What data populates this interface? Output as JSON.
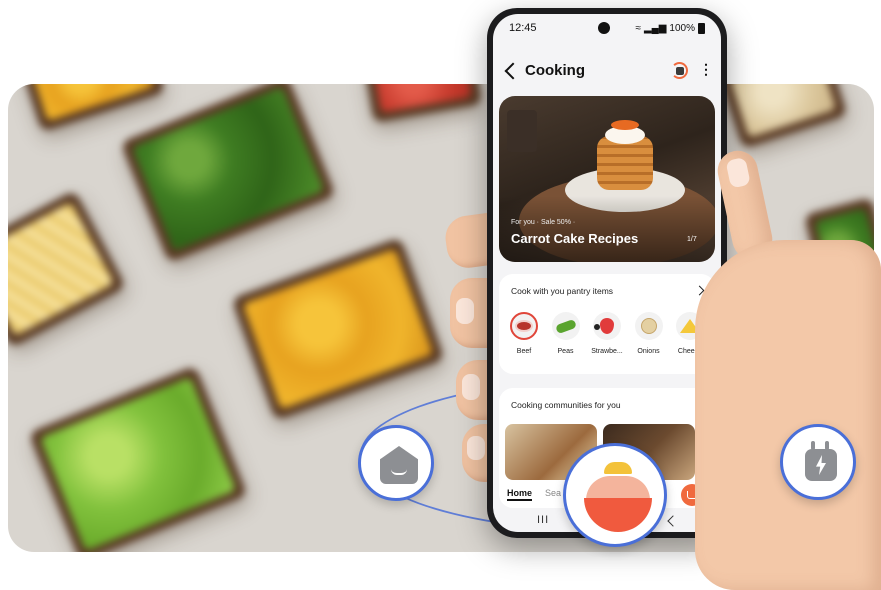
{
  "status_bar": {
    "time": "12:45",
    "battery": "100%"
  },
  "header": {
    "title": "Cooking"
  },
  "hero": {
    "subtitle": "For you · Sale 50% ·",
    "title": "Carrot Cake Recipes",
    "page": "1/7"
  },
  "pantry": {
    "title": "Cook with you pantry items",
    "items": [
      {
        "label": "Beef",
        "icon": "beef-icon"
      },
      {
        "label": "Peas",
        "icon": "peas-icon"
      },
      {
        "label": "Strawbe...",
        "icon": "strawberry-icon"
      },
      {
        "label": "Onions",
        "icon": "onion-icon"
      },
      {
        "label": "Cheese",
        "icon": "cheese-icon"
      }
    ]
  },
  "communities": {
    "title": "Cooking communities for you"
  },
  "bottom_nav": {
    "home": "Home",
    "search": "Sea"
  },
  "system_nav": {
    "recents": "III"
  },
  "colors": {
    "accent": "#f06a3e",
    "orbit": "#4a6fd8"
  }
}
